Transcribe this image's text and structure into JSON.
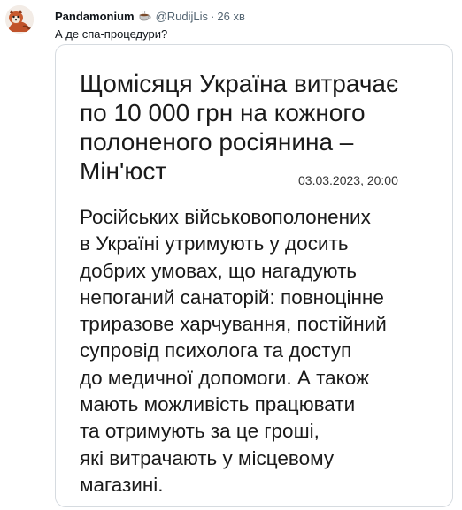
{
  "tweet": {
    "display_name": "Pandamonium",
    "name_emoji": "coffee-cup-icon",
    "handle": "@RudijLis",
    "separator": "·",
    "time": "26 хв",
    "text": "А де спа-процедури?"
  },
  "card": {
    "title_lines": [
      "Щомісяця Україна витрачає",
      "по 10 000 грн на кожного",
      "полоненого росіянина –",
      "Мін'юст"
    ],
    "date": "03.03.2023, 20:00",
    "body_lines": [
      "Російських військовополонених",
      "в Україні утримують у досить",
      "добрих умовах, що нагадують",
      "непоганий санаторій: повноцінне",
      "триразове харчування, постійний",
      "супровід психолога та доступ",
      "до медичної допомоги. А також",
      "мають можливість працювати",
      "та отримують за це гроші,",
      "які витрачають у місцевому",
      "магазині."
    ]
  },
  "colors": {
    "text": "#0f1419",
    "muted": "#536471",
    "card_border": "#d6dbe0"
  }
}
